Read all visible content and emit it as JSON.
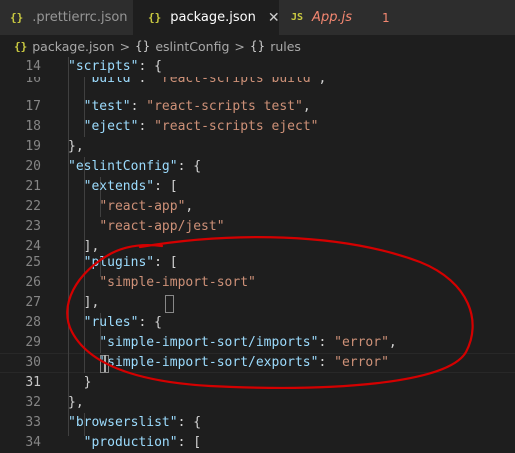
{
  "tabs": [
    {
      "icon": "{}",
      "label": ".prettierrc.json"
    },
    {
      "icon": "{}",
      "label": "package.json",
      "close": "✕"
    },
    {
      "icon": "JS",
      "label": "App.js",
      "problems": "1"
    }
  ],
  "breadcrumb": {
    "file": "package.json",
    "sep": ">",
    "path": [
      {
        "icon": "{}",
        "label": "eslintConfig"
      },
      {
        "icon": "{}",
        "label": "rules"
      }
    ]
  },
  "editor": {
    "line_numbers": [
      "14",
      "16",
      "17",
      "18",
      "19",
      "20",
      "21",
      "22",
      "23",
      "24",
      "25",
      "26",
      "27",
      "28",
      "29",
      "30",
      "31",
      "32",
      "33",
      "34"
    ],
    "lines": [
      "\"scripts\": {",
      "  \"build\": \"react-scripts build\",",
      "  \"test\": \"react-scripts test\",",
      "  \"eject\": \"react-scripts eject\"",
      "},",
      "\"eslintConfig\": {",
      "  \"extends\": [",
      "    \"react-app\",",
      "    \"react-app/jest\"",
      "  ],",
      "  \"plugins\": [",
      "    \"simple-import-sort\"",
      "  ],",
      "  \"rules\": {",
      "    \"simple-import-sort/imports\": \"error\",",
      "    \"simple-import-sort/exports\": \"error\"",
      "  }",
      "},",
      "\"browserslist\": {",
      "  \"production\": ["
    ],
    "active_line": "31"
  },
  "colors": {
    "annotation": "#d40000",
    "key": "#9cdcfe",
    "string": "#ce9178",
    "punctuation": "#d4d4d4",
    "json_icon": "#cbcb41"
  }
}
